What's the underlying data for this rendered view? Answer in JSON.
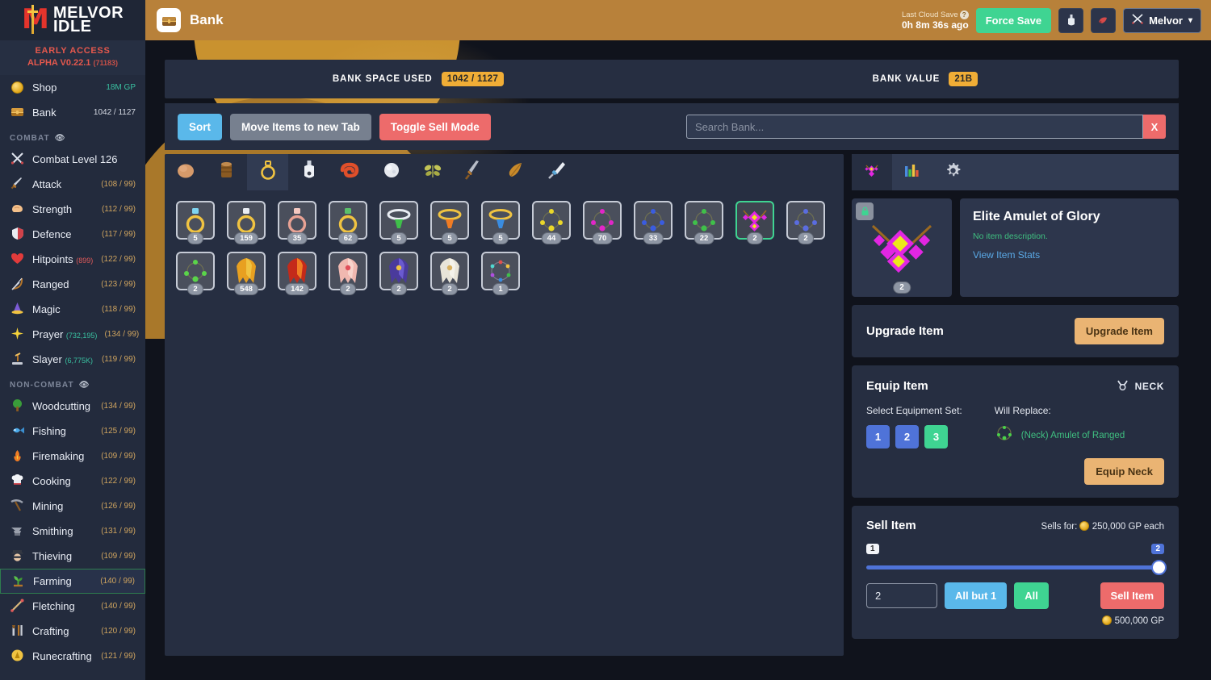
{
  "brand": {
    "line1": "MELVOR",
    "line2": "IDLE",
    "logo_icon": "melvor-logo-icon"
  },
  "version": {
    "tag": "EARLY ACCESS",
    "number": "ALPHA V0.22.1",
    "build": "(71183)"
  },
  "sidebar": {
    "top_links": [
      {
        "label": "Shop",
        "right": "18M GP",
        "icon": "coin-icon",
        "right_style": "gp"
      },
      {
        "label": "Bank",
        "right": "1042 / 1127",
        "icon": "chest-icon",
        "right_style": "plain"
      }
    ],
    "combat_header": "COMBAT",
    "combat_items": [
      {
        "label": "Combat Level 126",
        "right": "",
        "icon": "crossed-swords-icon"
      },
      {
        "label": "Attack",
        "right": "(108 / 99)",
        "icon": "sword-icon"
      },
      {
        "label": "Strength",
        "right": "(112 / 99)",
        "icon": "flexed-biceps-icon"
      },
      {
        "label": "Defence",
        "right": "(117 / 99)",
        "icon": "shield-icon"
      },
      {
        "label": "Hitpoints",
        "sub": "(899)",
        "right": "(122 / 99)",
        "icon": "heart-icon"
      },
      {
        "label": "Ranged",
        "right": "(123 / 99)",
        "icon": "bow-icon"
      },
      {
        "label": "Magic",
        "right": "(118 / 99)",
        "icon": "wizard-hat-icon"
      },
      {
        "label": "Prayer",
        "sub": "(732,195)",
        "right": "(134 / 99)",
        "icon": "prayer-star-icon"
      },
      {
        "label": "Slayer",
        "sub": "(6,775K)",
        "right": "(119 / 99)",
        "icon": "slayer-icon"
      }
    ],
    "noncombat_header": "NON-COMBAT",
    "noncombat_items": [
      {
        "label": "Woodcutting",
        "right": "(134 / 99)",
        "icon": "tree-icon"
      },
      {
        "label": "Fishing",
        "right": "(125 / 99)",
        "icon": "fish-icon"
      },
      {
        "label": "Firemaking",
        "right": "(109 / 99)",
        "icon": "campfire-icon"
      },
      {
        "label": "Cooking",
        "right": "(122 / 99)",
        "icon": "chef-hat-icon"
      },
      {
        "label": "Mining",
        "right": "(126 / 99)",
        "icon": "pickaxe-icon"
      },
      {
        "label": "Smithing",
        "right": "(131 / 99)",
        "icon": "anvil-icon"
      },
      {
        "label": "Thieving",
        "right": "(109 / 99)",
        "icon": "thief-icon"
      },
      {
        "label": "Farming",
        "right": "(140 / 99)",
        "icon": "seedling-icon",
        "active": true
      },
      {
        "label": "Fletching",
        "right": "(140 / 99)",
        "icon": "arrow-icon"
      },
      {
        "label": "Crafting",
        "right": "(120 / 99)",
        "icon": "tools-icon"
      },
      {
        "label": "Runecrafting",
        "right": "(121 / 99)",
        "icon": "rune-icon"
      }
    ]
  },
  "header": {
    "title": "Bank",
    "title_icon": "chest-icon",
    "cloud_save_label": "Last Cloud Save",
    "cloud_save_time": "0h 8m 36s ago",
    "force_save_label": "Force Save",
    "icon_buttons": [
      {
        "icon": "potion-icon"
      },
      {
        "icon": "pet-icon"
      }
    ],
    "user_name": "Melvor",
    "user_icon": "crossed-swords-icon",
    "chevron_icon": "chevron-down-icon"
  },
  "bank_stats": {
    "space_label": "BANK SPACE USED",
    "space_value": "1042 / 1127",
    "value_label": "BANK VALUE",
    "value_value": "21B"
  },
  "toolbar": {
    "sort_label": "Sort",
    "move_label": "Move Items to new Tab",
    "sell_mode_label": "Toggle Sell Mode",
    "search_placeholder": "Search Bank...",
    "search_value": "",
    "clear_label": "X"
  },
  "bank_tabs": [
    {
      "icon": "rock-icon",
      "active": false
    },
    {
      "icon": "log-icon",
      "active": false
    },
    {
      "icon": "ring-icon",
      "active": true
    },
    {
      "icon": "potion-icon",
      "active": false
    },
    {
      "icon": "fish-cooked-icon",
      "active": false
    },
    {
      "icon": "gem-icon",
      "active": false
    },
    {
      "icon": "herb-icon",
      "active": false
    },
    {
      "icon": "sword-icon",
      "active": false
    },
    {
      "icon": "feather-icon",
      "active": false
    },
    {
      "icon": "brush-icon",
      "active": false
    }
  ],
  "bank_items": [
    {
      "icon": "ring-diamond",
      "qty": "5",
      "selected": false
    },
    {
      "icon": "ring-plain-gold",
      "qty": "159",
      "selected": false
    },
    {
      "icon": "ring-rose",
      "qty": "35",
      "selected": false
    },
    {
      "icon": "ring-emerald",
      "qty": "62",
      "selected": false
    },
    {
      "icon": "amulet-green",
      "qty": "5",
      "selected": false
    },
    {
      "icon": "amulet-orange",
      "qty": "5",
      "selected": false
    },
    {
      "icon": "amulet-blue",
      "qty": "5",
      "selected": false
    },
    {
      "icon": "gem-cluster-yellow",
      "qty": "44",
      "selected": false
    },
    {
      "icon": "gem-cluster-magenta",
      "qty": "70",
      "selected": false
    },
    {
      "icon": "gem-cluster-blue",
      "qty": "33",
      "selected": false
    },
    {
      "icon": "gem-cluster-green",
      "qty": "22",
      "selected": false
    },
    {
      "icon": "amulet-glory-elite",
      "qty": "2",
      "selected": true
    },
    {
      "icon": "gem-cluster-indigo",
      "qty": "2",
      "selected": false
    },
    {
      "icon": "gem-cluster-lime",
      "qty": "2",
      "selected": false
    },
    {
      "icon": "cape-gold",
      "qty": "548",
      "selected": false
    },
    {
      "icon": "cape-fire",
      "qty": "142",
      "selected": false
    },
    {
      "icon": "cape-pink",
      "qty": "2",
      "selected": false
    },
    {
      "icon": "cape-purple",
      "qty": "2",
      "selected": false
    },
    {
      "icon": "cape-white",
      "qty": "2",
      "selected": false
    },
    {
      "icon": "ring-multicolor",
      "qty": "1",
      "selected": false
    }
  ],
  "right_tabs": [
    {
      "icon": "item-icon",
      "active": true
    },
    {
      "icon": "bar-chart-icon",
      "active": false
    },
    {
      "icon": "gear-icon",
      "active": false
    }
  ],
  "selected_item": {
    "name": "Elite Amulet of Glory",
    "description": "No item description.",
    "stats_link": "View Item Stats",
    "qty": "2",
    "lock_icon": "lock-icon"
  },
  "upgrade": {
    "title": "Upgrade Item",
    "button_label": "Upgrade Item"
  },
  "equip": {
    "title": "Equip Item",
    "slot_label": "NECK",
    "slot_icon": "neck-slot-icon",
    "set_label": "Select Equipment Set:",
    "sets": [
      {
        "label": "1",
        "active": false
      },
      {
        "label": "2",
        "active": false
      },
      {
        "label": "3",
        "active": true
      }
    ],
    "replace_label": "Will Replace:",
    "replace_item": "(Neck) Amulet of Ranged",
    "replace_icon": "amulet-ranged-icon",
    "button_label": "Equip Neck"
  },
  "sell": {
    "title": "Sell Item",
    "sells_for_label": "Sells for:",
    "unit_price": "250,000 GP each",
    "slider_min": "1",
    "slider_max": "2",
    "slider_value": "2",
    "qty_value": "2",
    "all_but_label": "All but 1",
    "all_label": "All",
    "sell_label": "Sell Item",
    "total_gp": "500,000 GP"
  }
}
